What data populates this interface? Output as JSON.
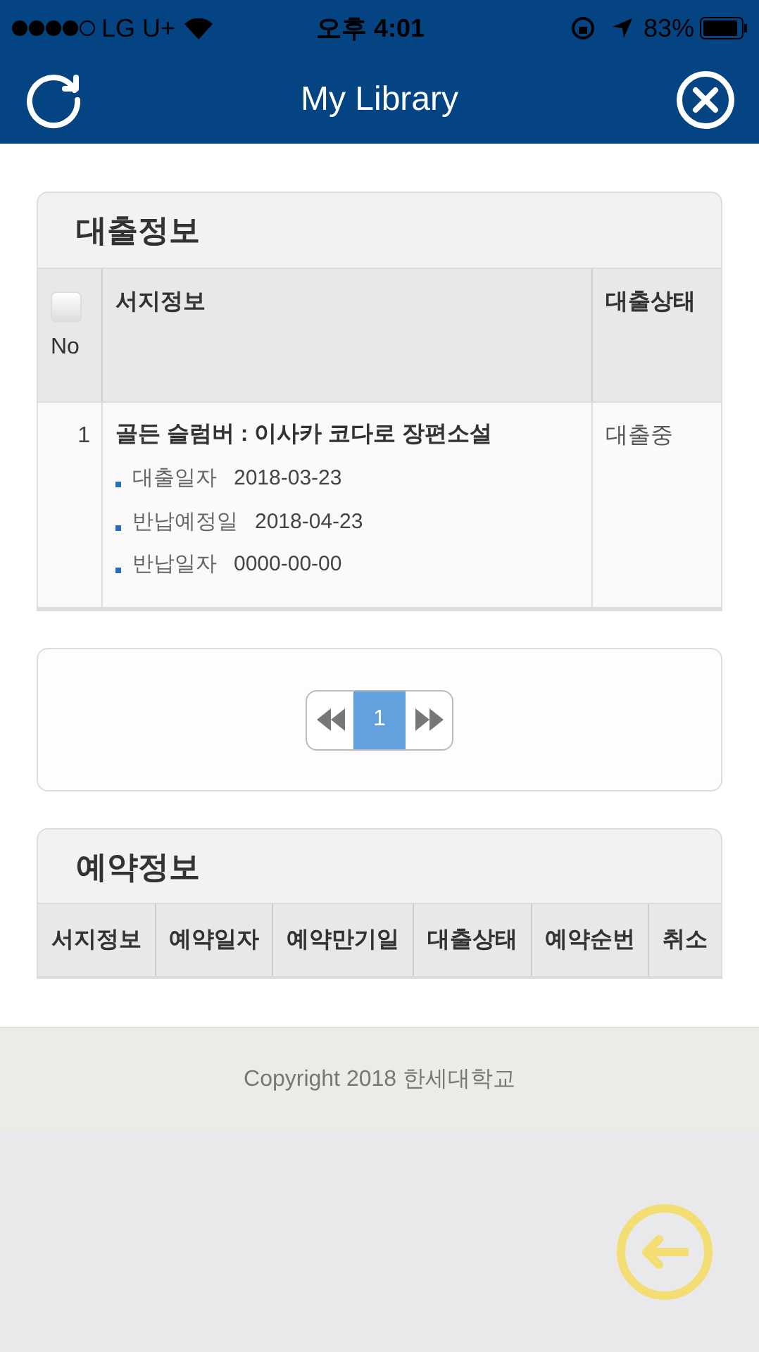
{
  "status_bar": {
    "carrier": "LG U+",
    "time": "오후 4:01",
    "battery": "83%"
  },
  "header": {
    "title": "My Library"
  },
  "loans": {
    "title": "대출정보",
    "select_all": {
      "checked": false
    },
    "columns": [
      "No",
      "서지정보",
      "대출상태"
    ],
    "rows": [
      {
        "no": "1",
        "title": "골든 슬럼버 : 이사카 코다로 장편소설",
        "details": [
          {
            "label": "대출일자",
            "value": "2018-03-23"
          },
          {
            "label": "반납예정일",
            "value": "2018-04-23"
          },
          {
            "label": "반납일자",
            "value": "0000-00-00"
          }
        ],
        "status": "대출중"
      }
    ]
  },
  "pagination": {
    "pages": [
      {
        "label": "1",
        "selected": true
      }
    ]
  },
  "reservations": {
    "title": "예약정보",
    "columns": [
      "서지정보",
      "예약일자",
      "예약만기일",
      "대출상태",
      "예약순번",
      "취소"
    ]
  },
  "footer": {
    "copyright": "Copyright 2018 한세대학교"
  }
}
